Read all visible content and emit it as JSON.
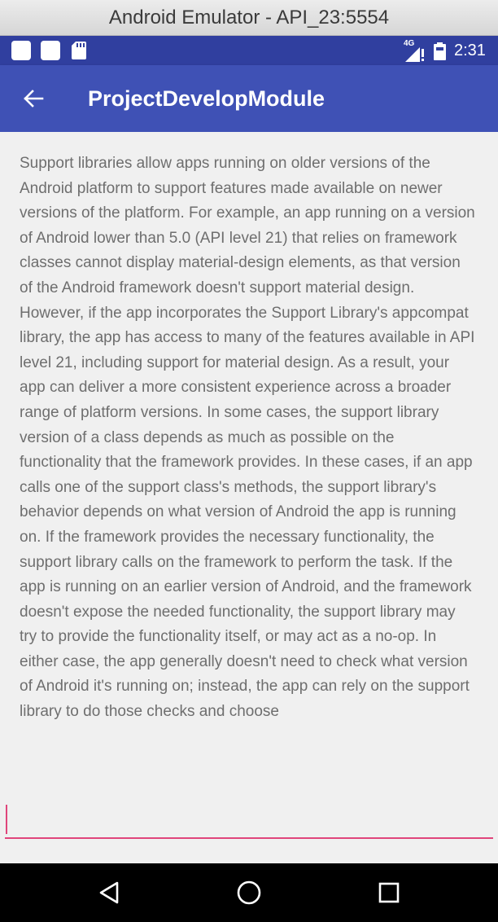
{
  "window": {
    "title": "Android Emulator - API_23:5554"
  },
  "status_bar": {
    "time": "2:31",
    "network_type": "4G",
    "notification_icons": [
      "app-notification-icon",
      "app-notification-icon",
      "sd-card-icon"
    ],
    "system_icons": [
      "signal-icon",
      "battery-icon"
    ],
    "background_color": "#303f9f"
  },
  "toolbar": {
    "title": "ProjectDevelopModule",
    "nav_icon": "back-arrow-icon",
    "background_color": "#3f51b5"
  },
  "content": {
    "text": "Support libraries allow apps running on older versions of the Android platform to support features made available on newer versions of the platform. For example, an app running on a version of Android lower than 5.0 (API level 21) that relies on framework classes cannot display material-design elements, as that version of the Android framework doesn't support material design. However, if the app incorporates the Support Library's appcompat library, the app has access to many of the features available in API level 21, including support for material design. As a result, your app can deliver a more consistent experience across a broader range of platform versions.  In some cases, the support library version of a class depends as much as possible on the functionality that the framework provides. In these cases, if an app calls one of the support class's methods, the support library's behavior depends on what version of Android the app is running on. If the framework provides the necessary functionality, the support library calls on the framework to perform the task. If the app is running on an earlier version of Android, and the framework doesn't expose the needed functionality, the support library may try to provide the functionality itself, or may act as a no-op. In either case, the app generally doesn't need to check what version of Android it's running on; instead, the app can rely on the support library to do those checks and choose",
    "input_value": "",
    "accent_color": "#e0457b"
  },
  "nav_bar": {
    "buttons": [
      "back-triangle-icon",
      "home-circle-icon",
      "recents-square-icon"
    ]
  }
}
